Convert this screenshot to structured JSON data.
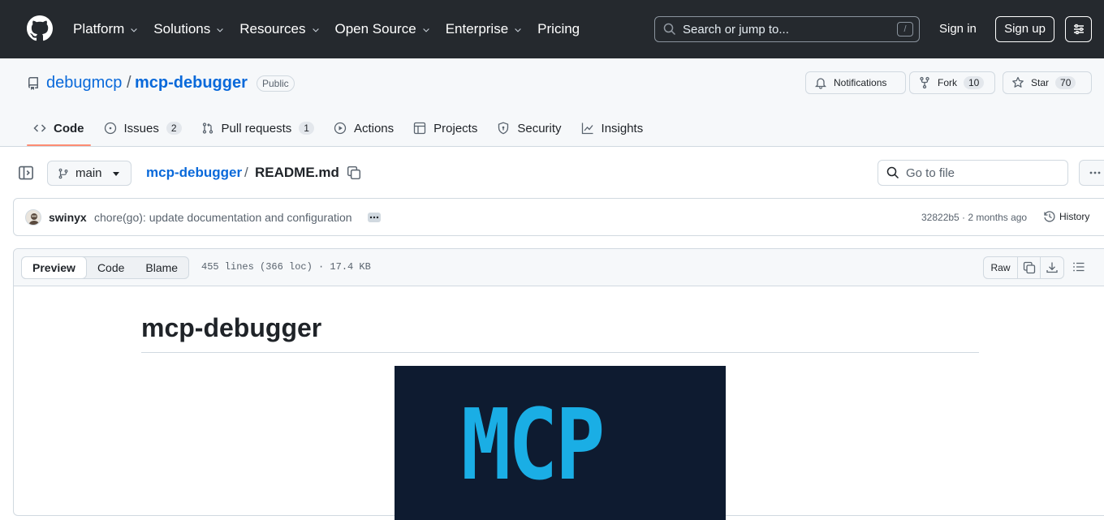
{
  "header": {
    "nav": [
      {
        "label": "Platform",
        "dropdown": true
      },
      {
        "label": "Solutions",
        "dropdown": true
      },
      {
        "label": "Resources",
        "dropdown": true
      },
      {
        "label": "Open Source",
        "dropdown": true
      },
      {
        "label": "Enterprise",
        "dropdown": true
      },
      {
        "label": "Pricing",
        "dropdown": false
      }
    ],
    "search_placeholder": "Search or jump to...",
    "search_shortcut": "/",
    "sign_in": "Sign in",
    "sign_up": "Sign up"
  },
  "repo": {
    "owner": "debugmcp",
    "separator": "/",
    "name": "mcp-debugger",
    "visibility": "Public",
    "notifications_label": "Notifications",
    "fork_label": "Fork",
    "fork_count": "10",
    "star_label": "Star",
    "star_count": "70"
  },
  "tabs": [
    {
      "label": "Code",
      "icon": "code-icon",
      "count": null,
      "active": true
    },
    {
      "label": "Issues",
      "icon": "issue-icon",
      "count": "2",
      "active": false
    },
    {
      "label": "Pull requests",
      "icon": "pull-request-icon",
      "count": "1",
      "active": false
    },
    {
      "label": "Actions",
      "icon": "play-icon",
      "count": null,
      "active": false
    },
    {
      "label": "Projects",
      "icon": "table-icon",
      "count": null,
      "active": false
    },
    {
      "label": "Security",
      "icon": "shield-icon",
      "count": null,
      "active": false
    },
    {
      "label": "Insights",
      "icon": "graph-icon",
      "count": null,
      "active": false
    }
  ],
  "filenav": {
    "branch": "main",
    "breadcrumb_repo": "mcp-debugger",
    "breadcrumb_sep": "/",
    "file_name": "README.md",
    "goto_placeholder": "Go to file"
  },
  "commit": {
    "author": "swinyx",
    "message": "chore(go): update documentation and configuration",
    "meta": "32822b5 · 2 months ago",
    "history_label": "History"
  },
  "file": {
    "views": [
      "Preview",
      "Code",
      "Blame"
    ],
    "active_view": "Preview",
    "info": "455 lines (366 loc) · 17.4 KB",
    "raw_label": "Raw"
  },
  "readme": {
    "title": "mcp-debugger",
    "logo_text": "MCP"
  },
  "colors": {
    "header_bg": "#25292e",
    "link": "#0969da",
    "active_tab_underline": "#fd8c73",
    "logo_bg": "#0e1b30",
    "logo_fg": "#1aaee5"
  }
}
